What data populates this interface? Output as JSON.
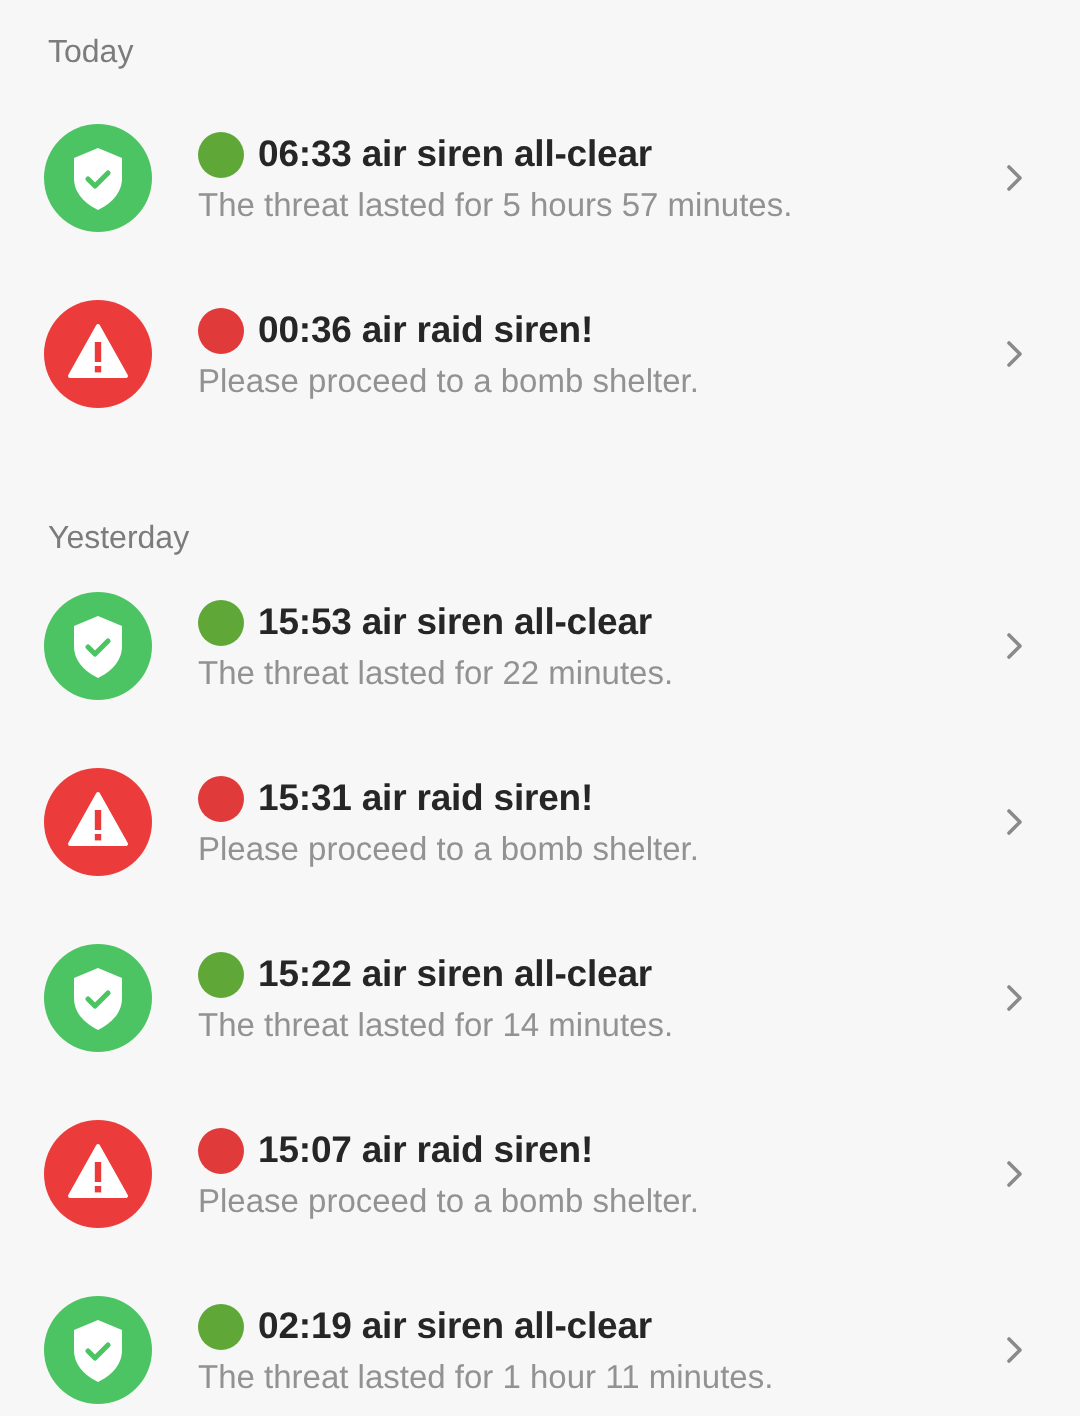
{
  "sections": [
    {
      "header": "Today",
      "items": [
        {
          "kind": "all-clear",
          "title": "06:33 air siren all-clear",
          "subtitle": "The threat lasted for 5 hours 57 minutes."
        },
        {
          "kind": "alert",
          "title": "00:36 air raid siren!",
          "subtitle": "Please proceed to a bomb shelter."
        }
      ]
    },
    {
      "header": "Yesterday",
      "items": [
        {
          "kind": "all-clear",
          "title": "15:53 air siren all-clear",
          "subtitle": "The threat lasted for 22 minutes."
        },
        {
          "kind": "alert",
          "title": "15:31 air raid siren!",
          "subtitle": "Please proceed to a bomb shelter."
        },
        {
          "kind": "all-clear",
          "title": "15:22 air siren all-clear",
          "subtitle": "The threat lasted for 14 minutes."
        },
        {
          "kind": "alert",
          "title": "15:07 air raid siren!",
          "subtitle": "Please proceed to a bomb shelter."
        },
        {
          "kind": "all-clear",
          "title": "02:19 air siren all-clear",
          "subtitle": "The threat lasted for 1 hour 11 minutes."
        }
      ]
    }
  ]
}
